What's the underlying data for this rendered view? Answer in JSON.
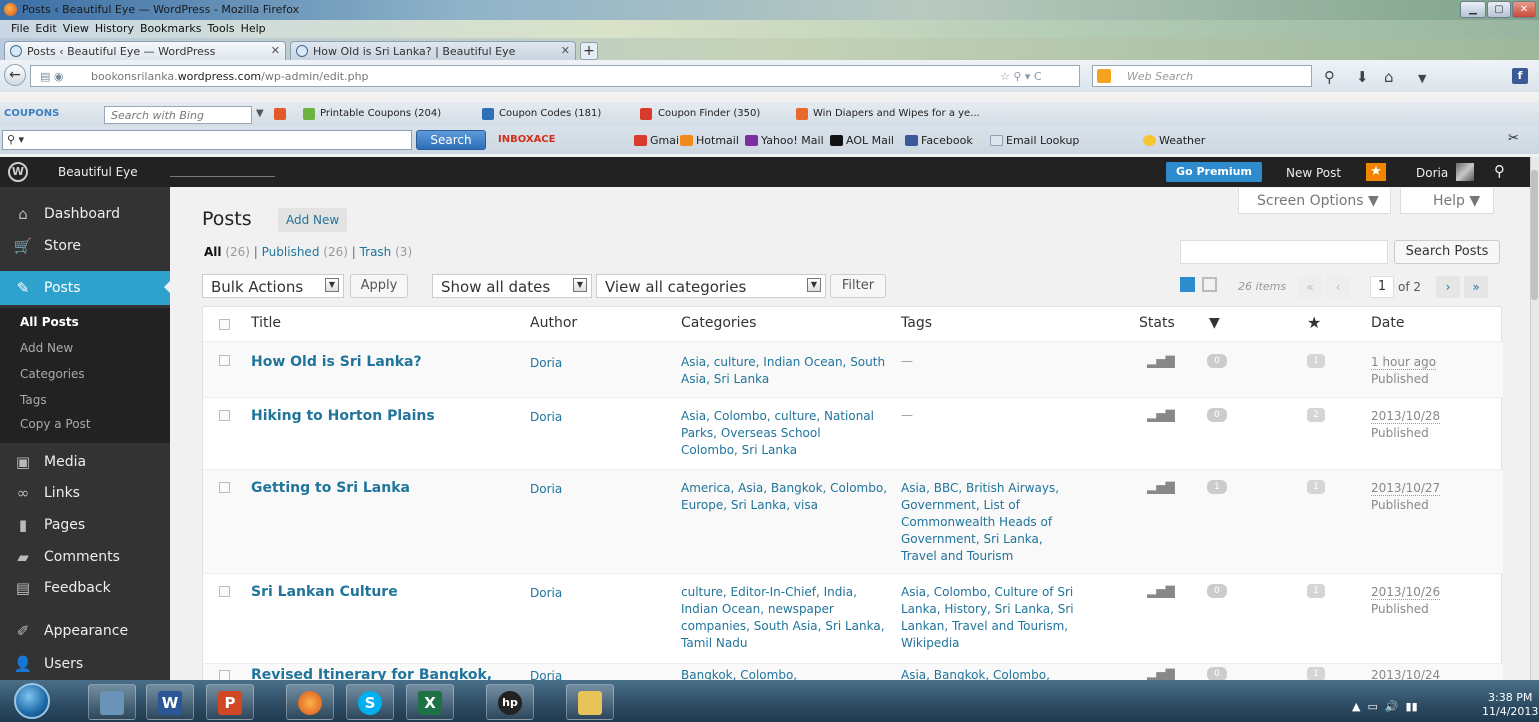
{
  "browser": {
    "window_title": "Posts ‹ Beautiful Eye — WordPress - Mozilla Firefox",
    "menu": [
      "File",
      "Edit",
      "View",
      "History",
      "Bookmarks",
      "Tools",
      "Help"
    ],
    "tabs": [
      {
        "label": "Posts ‹ Beautiful Eye — WordPress"
      },
      {
        "label": "How Old is Sri Lanka? | Beautiful Eye"
      }
    ],
    "url_prefix": "bookonsrilanka.",
    "url_domain": "wordpress.com",
    "url_path": "/wp-admin/edit.php",
    "web_search_placeholder": "Web Search",
    "coupon_logo": "COUPONS",
    "bing_placeholder": "Search with Bing",
    "bookmarks": [
      "Printable Coupons (204)",
      "Coupon Codes (181)",
      "Coupon Finder (350)",
      "Win Diapers and Wipes for a ye..."
    ],
    "search_button": "Search",
    "links": {
      "inboxace": "INBOXACE",
      "gmail": "Gmail",
      "hotmail": "Hotmail",
      "yahoo": "Yahoo! Mail",
      "aol": "AOL Mail",
      "facebook": "Facebook",
      "email_lookup": "Email Lookup",
      "weather": "Weather"
    }
  },
  "adminbar": {
    "site_name": "Beautiful Eye",
    "go_premium": "Go Premium",
    "new_post": "New Post",
    "user": "Doria"
  },
  "sidebar": {
    "items": {
      "dashboard": "Dashboard",
      "store": "Store",
      "posts": "Posts",
      "media": "Media",
      "links": "Links",
      "pages": "Pages",
      "comments": "Comments",
      "feedback": "Feedback",
      "appearance": "Appearance",
      "users": "Users"
    },
    "posts_submenu": [
      "All Posts",
      "Add New",
      "Categories",
      "Tags",
      "Copy a Post"
    ]
  },
  "page": {
    "title": "Posts",
    "add_new": "Add New",
    "screen_options": "Screen Options ▼",
    "help": "Help ▼",
    "filters": {
      "all_label": "All",
      "all_count": "(26)",
      "published_label": "Published",
      "published_count": "(26)",
      "trash_label": "Trash",
      "trash_count": "(3)"
    },
    "search_posts": "Search Posts",
    "bulk_actions": "Bulk Actions",
    "apply": "Apply",
    "all_dates": "Show all dates",
    "all_categories": "View all categories",
    "filter": "Filter",
    "items_count": "26 items",
    "current_page": "1",
    "of_pages": "of 2"
  },
  "table": {
    "headers": {
      "title": "Title",
      "author": "Author",
      "categories": "Categories",
      "tags": "Tags",
      "stats": "Stats",
      "date": "Date"
    },
    "rows": [
      {
        "title": "How Old is Sri Lanka?",
        "author": "Doria",
        "categories": "Asia, culture, Indian Ocean, South Asia, Sri Lanka",
        "tags": "—",
        "comments": "0",
        "likes": "1",
        "date": "1 hour ago",
        "status": "Published"
      },
      {
        "title": "Hiking to Horton Plains",
        "author": "Doria",
        "categories": "Asia, Colombo, culture, National Parks, Overseas School Colombo, Sri Lanka",
        "tags": "—",
        "comments": "0",
        "likes": "2",
        "date": "2013/10/28",
        "status": "Published"
      },
      {
        "title": "Getting to Sri Lanka",
        "author": "Doria",
        "categories": "America, Asia, Bangkok, Colombo, Europe, Sri Lanka, visa",
        "tags": "Asia, BBC, British Airways, Government, List of Commonwealth Heads of Government, Sri Lanka, Travel and Tourism",
        "comments": "1",
        "likes": "1",
        "date": "2013/10/27",
        "status": "Published"
      },
      {
        "title": "Sri Lankan Culture",
        "author": "Doria",
        "categories": "culture, Editor-In-Chief, India, Indian Ocean, newspaper companies, South Asia, Sri Lanka, Tamil Nadu",
        "tags": "Asia, Colombo, Culture of Sri Lanka, History, Sri Lanka, Sri Lankan, Travel and Tourism, Wikipedia",
        "comments": "0",
        "likes": "1",
        "date": "2013/10/26",
        "status": "Published"
      },
      {
        "title": "Revised Itinerary for Bangkok,",
        "author": "Doria",
        "categories": "Bangkok, Colombo,",
        "tags": "Asia, Bangkok, Colombo,",
        "comments": "0",
        "likes": "1",
        "date": "2013/10/24",
        "status": ""
      }
    ]
  },
  "taskbar": {
    "time": "3:38 PM",
    "date": "11/4/2013"
  }
}
